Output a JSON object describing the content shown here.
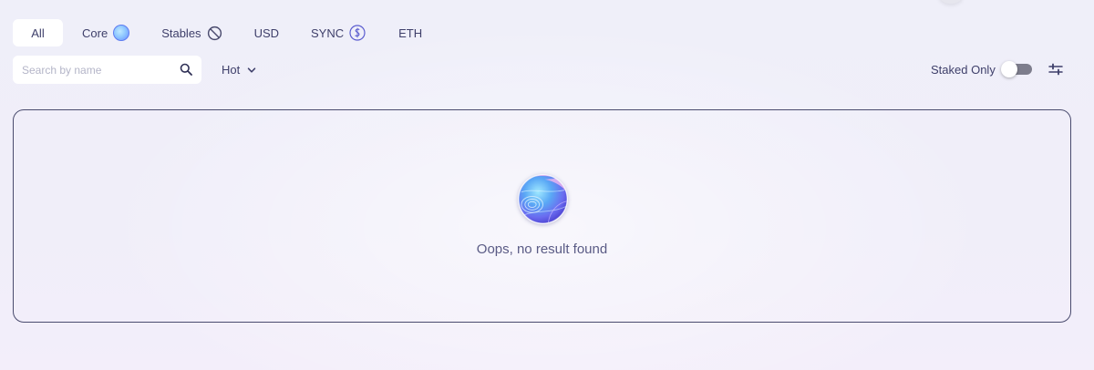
{
  "tabs": [
    {
      "label": "All",
      "active": true
    },
    {
      "label": "Core",
      "icon": "core-token-icon"
    },
    {
      "label": "Stables",
      "icon": "prohibited-icon"
    },
    {
      "label": "USD"
    },
    {
      "label": "SYNC",
      "icon": "sync-token-icon"
    },
    {
      "label": "ETH"
    }
  ],
  "toolbar": {
    "search_placeholder": "Search by name",
    "search_value": "",
    "sort_selected": "Hot",
    "staked_only_label": "Staked Only",
    "staked_only_on": false
  },
  "empty_state": {
    "message": "Oops, no result found",
    "icon": "empty-orb-icon"
  },
  "colors": {
    "background": "#f0eef9",
    "panel_border": "#4a4b6e",
    "text": "#3e3f6a",
    "toggle_track": "#7d7d8c"
  }
}
